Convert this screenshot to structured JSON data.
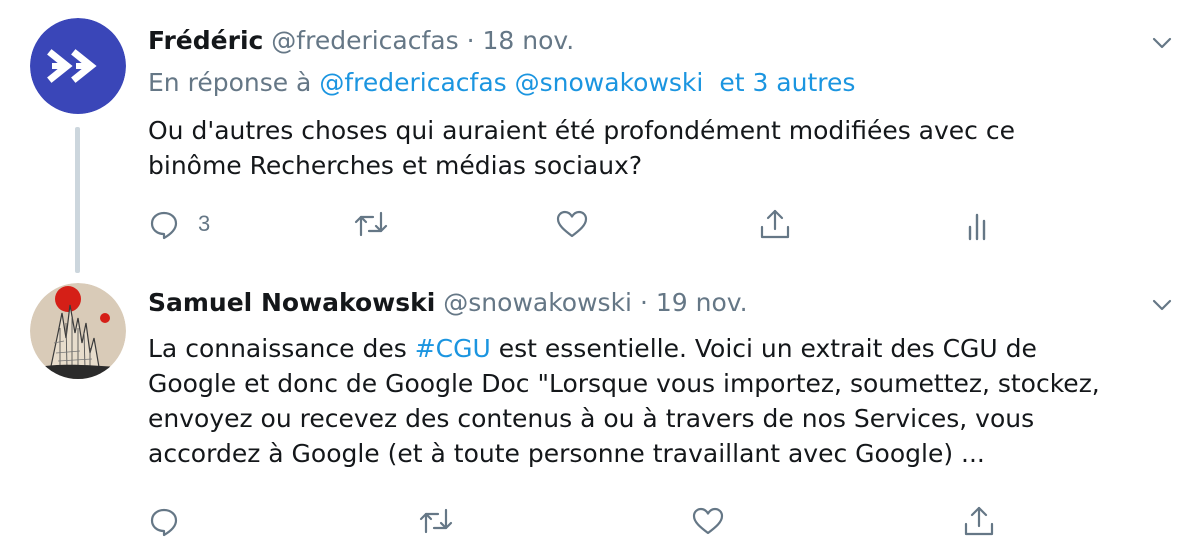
{
  "tweets": [
    {
      "name": "Frédéric",
      "handle": "@fredericacfas",
      "separator": "·",
      "date": "18 nov.",
      "reply": {
        "prefix": "En réponse à",
        "mentions": [
          "@fredericacfas",
          "@snowakowski"
        ],
        "others": "et 3 autres"
      },
      "text_lines": [
        "Ou d'autres choses qui auraient été profondément modifiées avec ce",
        "binôme Recherches et médias sociaux?"
      ],
      "reply_count": "3",
      "avatar_icon": "fast-forward-icon",
      "avatar_color": "#3a46b8"
    },
    {
      "name": "Samuel Nowakowski",
      "handle": "@snowakowski",
      "separator": "·",
      "date": "19 nov.",
      "text": {
        "line1_before": "La connaissance des",
        "hashtag": "#CGU",
        "line1_after": "est essentielle. Voici un extrait des CGU de",
        "line2": "Google et donc de Google Doc \"Lorsque vous importez, soumettez, stockez,",
        "line3": "envoyez ou recevez des contenus à ou à travers de nos Services, vous",
        "line4": "accordez à Google (et à toute personne travaillant avec Google) ..."
      },
      "avatar_icon": "artwork-avatar"
    }
  ],
  "colors": {
    "link": "#1b95e0",
    "muted": "#657786",
    "thread_line": "#ccd6dd"
  }
}
